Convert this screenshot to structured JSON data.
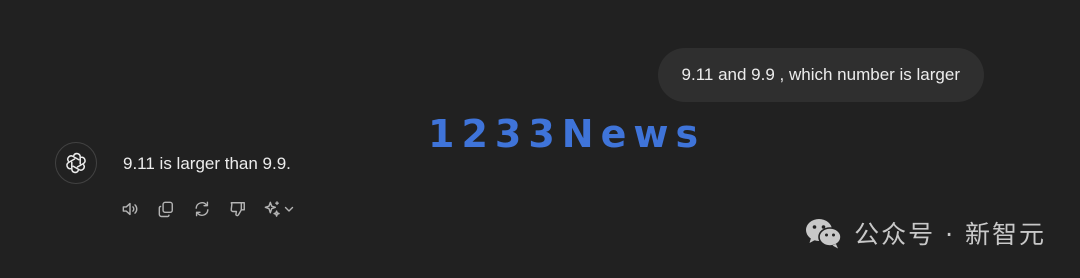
{
  "conversation": {
    "user_message": "9.11 and 9.9 , which number is larger",
    "assistant_message": "9.11 is larger than 9.9."
  },
  "actions": [
    {
      "name": "read-aloud",
      "icon": "speaker-icon"
    },
    {
      "name": "copy",
      "icon": "copy-icon"
    },
    {
      "name": "regenerate",
      "icon": "refresh-icon"
    },
    {
      "name": "bad-response",
      "icon": "thumbs-down-icon"
    },
    {
      "name": "change-model",
      "icon": "sparkle-icon"
    }
  ],
  "watermark": "1233News",
  "brand": "公众号 · 新智元",
  "colors": {
    "background": "#212121",
    "user_bubble": "#2f2f2f",
    "text": "#ececec",
    "icon": "#b4b4b4",
    "watermark": "#3f74d9"
  }
}
